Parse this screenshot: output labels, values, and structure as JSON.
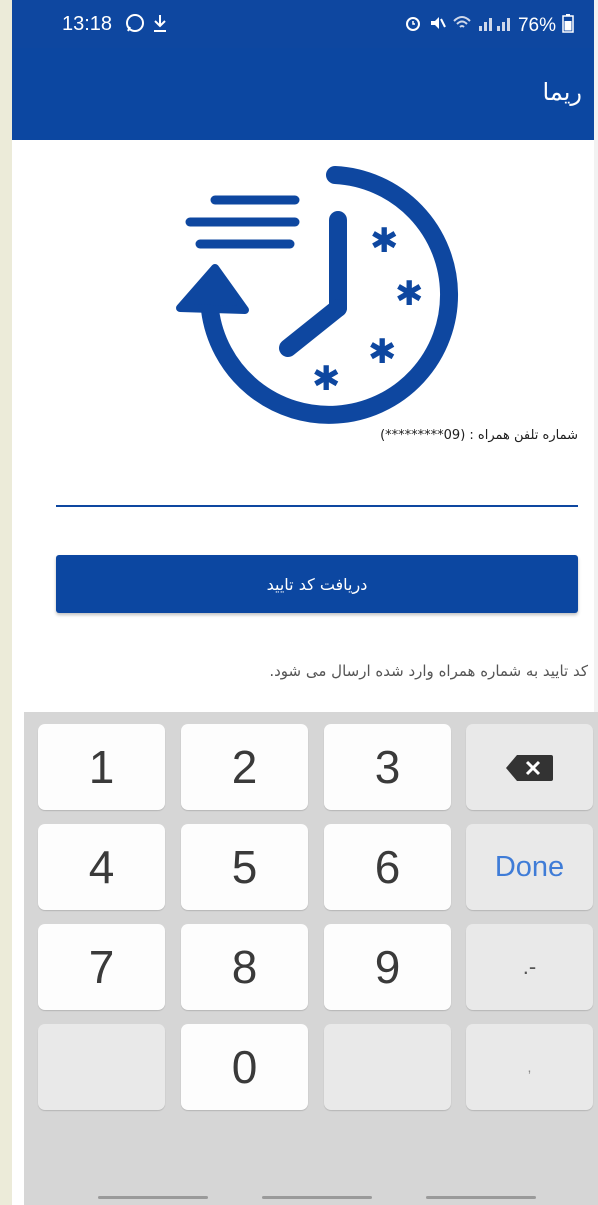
{
  "status_bar": {
    "time": "13:18",
    "battery": "76%",
    "icons": [
      "whatsapp-icon",
      "download-icon",
      "alarm-icon",
      "mute-icon",
      "wifi-icon",
      "signal-icon",
      "battery-icon"
    ]
  },
  "app_bar": {
    "title": "ریما"
  },
  "logo": {
    "name": "clock-history-logo",
    "color": "#0e47a0"
  },
  "form": {
    "phone_label": "شماره تلفن همراه : (09*********)",
    "phone_value": "",
    "submit_label": "دریافت کد تایید",
    "hint": "کد تایید به شماره همراه وارد شده ارسال می شود."
  },
  "keyboard": {
    "keys": [
      "1",
      "2",
      "3",
      "4",
      "5",
      "6",
      "7",
      "8",
      "9",
      "0"
    ],
    "done_label": "Done",
    "symbols_label": ".-",
    "comma_label": ",",
    "backspace_icon": "backspace-icon"
  },
  "colors": {
    "primary": "#0c47a1",
    "keyboard_bg": "#d6d6d6",
    "done_text": "#3f7cd7"
  }
}
